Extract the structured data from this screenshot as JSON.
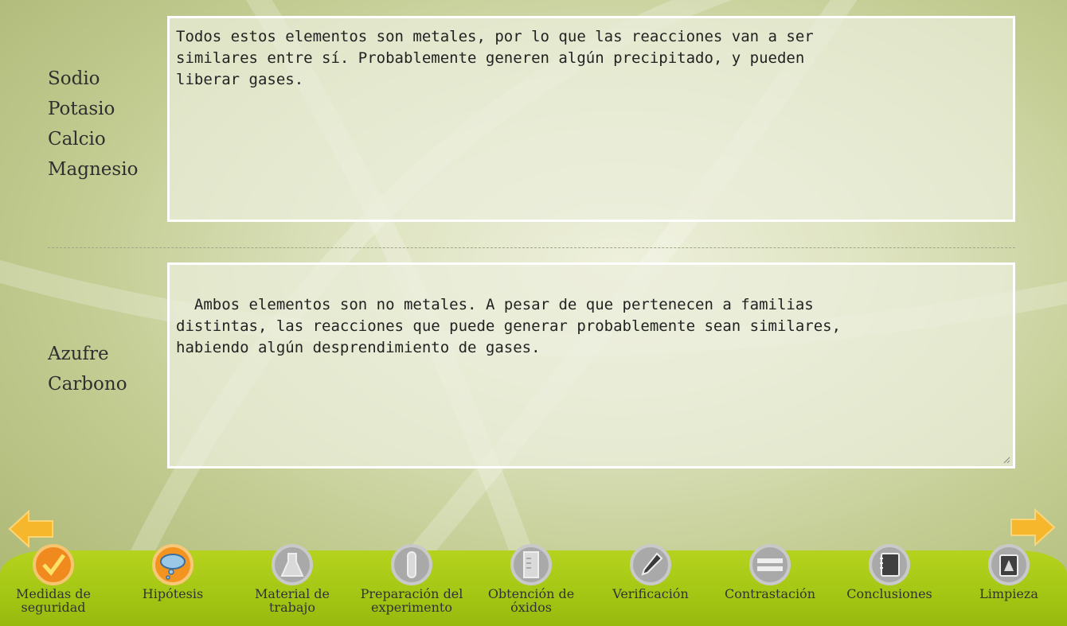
{
  "rows": [
    {
      "elements": [
        "Sodio",
        "Potasio",
        "Calcio",
        "Magnesio"
      ],
      "hypothesis": "Todos estos elementos son metales, por lo que las reacciones van a ser\nsimilares entre sí. Probablemente generen algún precipitado, y pueden\nliberar gases."
    },
    {
      "elements": [
        "Azufre",
        "Carbono"
      ],
      "hypothesis": "Ambos elementos son no metales. A pesar de que pertenecen a familias\ndistintas, las reacciones que puede generar probablemente sean similares,\nhabiendo algún desprendimiento de gases."
    }
  ],
  "nav": {
    "prev_icon": "arrow-left-icon",
    "next_icon": "arrow-right-icon",
    "arrow_color": "#f7b72c",
    "items": [
      {
        "label": "Medidas de\nseguridad",
        "icon": "checkmark-icon",
        "state": "done"
      },
      {
        "label": "Hipótesis",
        "icon": "thought-cloud-icon",
        "state": "active"
      },
      {
        "label": "Material de\ntrabajo",
        "icon": "flask-icon",
        "state": "pending"
      },
      {
        "label": "Preparación del\nexperimento",
        "icon": "test-tube-icon",
        "state": "pending"
      },
      {
        "label": "Obtención de\nóxidos",
        "icon": "graduated-cylinder-icon",
        "state": "pending"
      },
      {
        "label": "Verificación",
        "icon": "dropper-icon",
        "state": "pending"
      },
      {
        "label": "Contrastación",
        "icon": "equals-icon",
        "state": "pending"
      },
      {
        "label": "Conclusiones",
        "icon": "notebook-icon",
        "state": "pending"
      },
      {
        "label": "Limpieza",
        "icon": "trash-can-icon",
        "state": "pending"
      }
    ]
  }
}
